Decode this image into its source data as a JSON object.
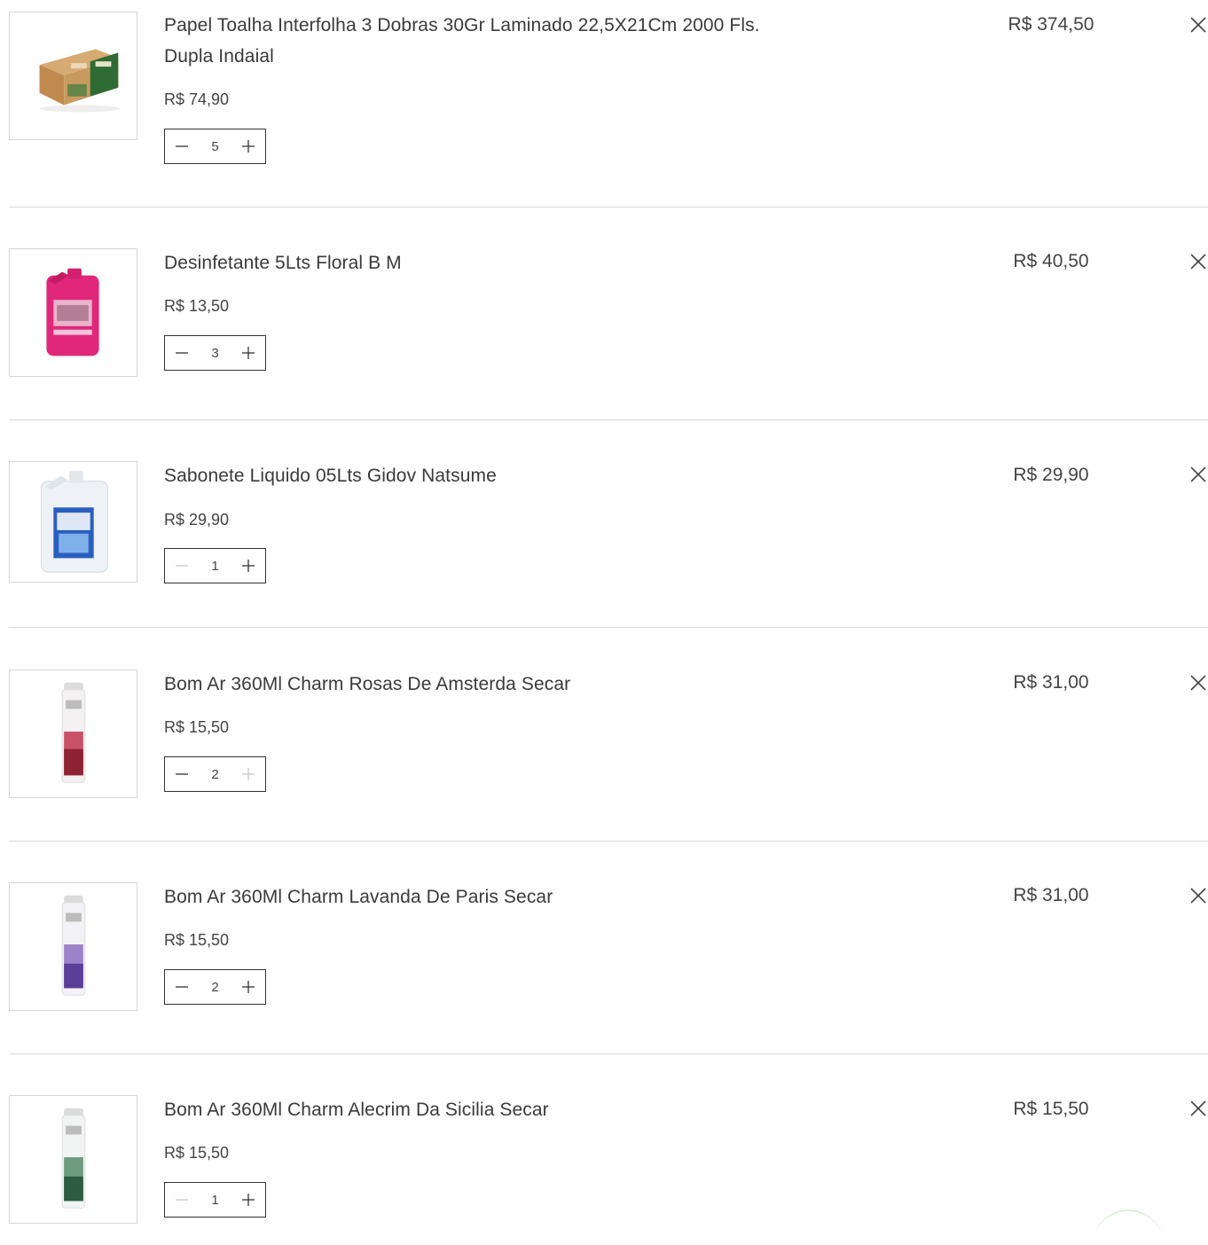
{
  "cart": {
    "items": [
      {
        "name": "Papel Toalha Interfolha 3 Dobras 30Gr Laminado 22,5X21Cm 2000 Fls. Dupla Indaial",
        "unit_price": "R$ 74,90",
        "quantity": "5",
        "total": "R$ 374,50",
        "image": "paper-towel-box",
        "minus_disabled": false,
        "plus_disabled": false
      },
      {
        "name": "Desinfetante 5Lts Floral B M",
        "unit_price": "R$ 13,50",
        "quantity": "3",
        "total": "R$ 40,50",
        "image": "pink-disinfectant-jug",
        "minus_disabled": false,
        "plus_disabled": false
      },
      {
        "name": "Sabonete Liquido 05Lts Gidov Natsume",
        "unit_price": "R$ 29,90",
        "quantity": "1",
        "total": "R$ 29,90",
        "image": "liquid-soap-jug",
        "minus_disabled": true,
        "plus_disabled": false
      },
      {
        "name": "Bom Ar 360Ml Charm Rosas De Amsterda Secar",
        "unit_price": "R$ 15,50",
        "quantity": "2",
        "total": "R$ 31,00",
        "image": "air-freshener-rose",
        "minus_disabled": false,
        "plus_disabled": true
      },
      {
        "name": "Bom Ar 360Ml Charm Lavanda De Paris Secar",
        "unit_price": "R$ 15,50",
        "quantity": "2",
        "total": "R$ 31,00",
        "image": "air-freshener-lavender",
        "minus_disabled": false,
        "plus_disabled": false
      },
      {
        "name": "Bom Ar 360Ml Charm Alecrim Da Sicilia Secar",
        "unit_price": "R$ 15,50",
        "quantity": "1",
        "total": "R$ 15,50",
        "image": "air-freshener-rosemary",
        "minus_disabled": true,
        "plus_disabled": false
      }
    ]
  },
  "colors": {
    "text": "#3a3a3a",
    "border": "#d6d6d6",
    "divider": "#d9d9d9",
    "qty_border": "#333333",
    "disabled_icon": "#c8c8c8"
  }
}
